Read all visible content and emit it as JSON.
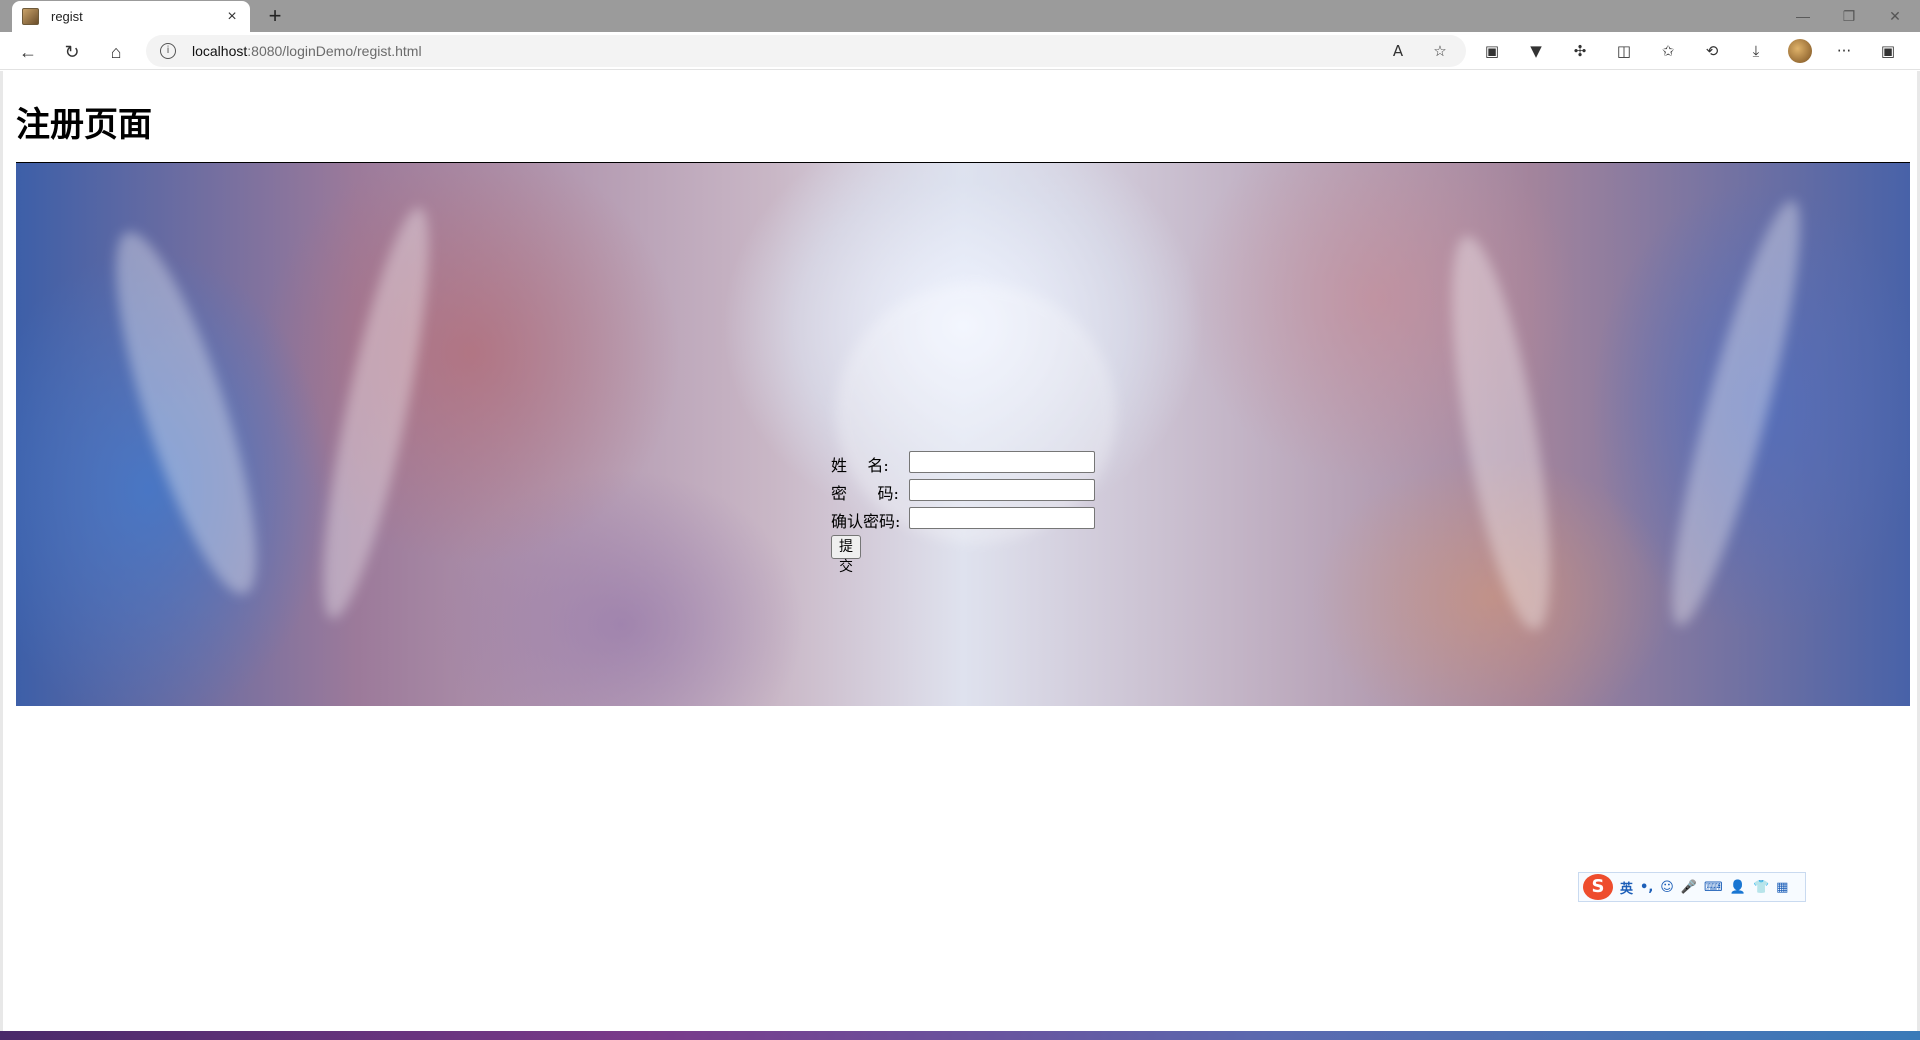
{
  "browser": {
    "tab_title": "regist",
    "tab_close": "×",
    "new_tab": "+",
    "window_controls": {
      "minimize": "—",
      "restore": "❐",
      "close": "✕"
    },
    "address": {
      "host": "localhost",
      "path": ":8080/loginDemo/regist.html"
    },
    "nav": {
      "back": "←",
      "reload": "↻",
      "home": "⌂"
    },
    "address_icons": {
      "read_aloud": "A",
      "favorite": "☆"
    },
    "toolbar_icons": {
      "split": "◫",
      "favorites": "✩",
      "history": "⟲",
      "downloads": "⤓",
      "more": "···",
      "sidebar": "▣"
    }
  },
  "page": {
    "heading": "注册页面",
    "form": {
      "name_label": "姓    名:",
      "password_label": "密      码:",
      "confirm_label": "确认密码:",
      "name_value": "",
      "password_value": "",
      "confirm_value": "",
      "submit_label": "提交"
    }
  },
  "ime": {
    "logo": "S",
    "mode": "英",
    "punct": "•,",
    "icons": [
      "☺",
      "🎤",
      "⌨",
      "👤",
      "👕",
      "▦"
    ]
  }
}
